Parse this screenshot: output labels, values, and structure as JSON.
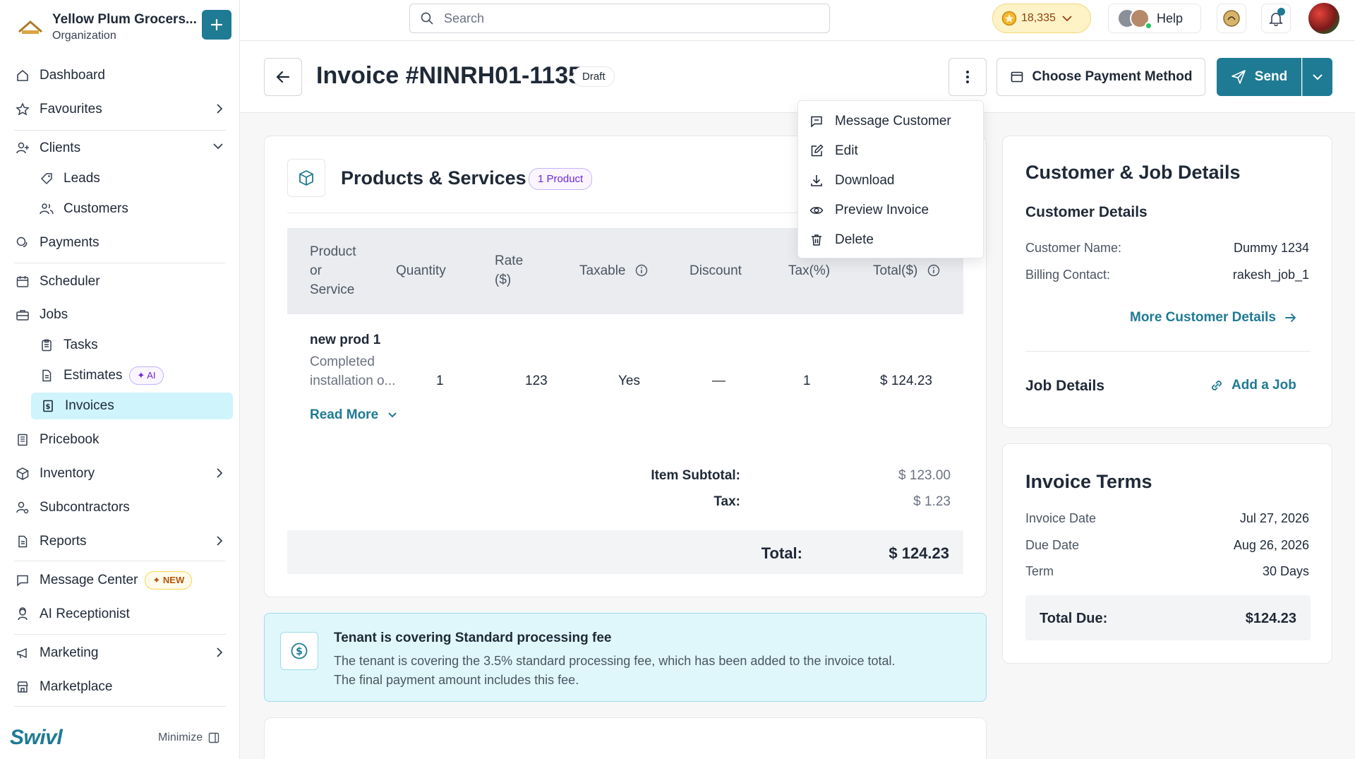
{
  "org": {
    "name": "Yellow Plum Grocers...",
    "type": "Organization"
  },
  "nav": {
    "dashboard": "Dashboard",
    "favourites": "Favourites",
    "clients": "Clients",
    "leads": "Leads",
    "customers": "Customers",
    "payments": "Payments",
    "scheduler": "Scheduler",
    "jobs": "Jobs",
    "tasks": "Tasks",
    "estimates": "Estimates",
    "estimates_badge": "AI",
    "invoices": "Invoices",
    "pricebook": "Pricebook",
    "inventory": "Inventory",
    "subcontractors": "Subcontractors",
    "reports": "Reports",
    "message_center": "Message Center",
    "message_center_badge": "NEW",
    "ai_receptionist": "AI Receptionist",
    "marketing": "Marketing",
    "marketplace": "Marketplace"
  },
  "brand": "Swivl",
  "minimize_label": "Minimize",
  "topbar": {
    "search_placeholder": "Search",
    "coins": "18,335",
    "help": "Help"
  },
  "header": {
    "title": "Invoice #NINRH01-1135",
    "status": "Draft",
    "choose_payment": "Choose Payment Method",
    "send": "Send"
  },
  "menu": {
    "message_customer": "Message Customer",
    "edit": "Edit",
    "download": "Download",
    "preview": "Preview Invoice",
    "delete": "Delete"
  },
  "products": {
    "title": "Products & Services",
    "badge": "1 Product",
    "columns": {
      "product_line1": "Product",
      "product_line2": "or",
      "product_line3": "Service",
      "quantity": "Quantity",
      "rate_line1": "Rate",
      "rate_line2": "($)",
      "taxable": "Taxable",
      "discount": "Discount",
      "tax": "Tax(%)",
      "total": "Total($)"
    },
    "row": {
      "name": "new prod 1",
      "desc_line1": "Completed",
      "desc_line2": "installation o...",
      "quantity": "1",
      "rate": "123",
      "taxable": "Yes",
      "discount": "—",
      "tax": "1",
      "total": "$ 124.23"
    },
    "read_more": "Read More",
    "subtotal_label": "Item Subtotal:",
    "subtotal_value": "$ 123.00",
    "tax_label": "Tax:",
    "tax_value": "$ 1.23",
    "total_label": "Total:",
    "total_value": "$ 124.23"
  },
  "fee": {
    "title": "Tenant is covering Standard processing fee",
    "line1": "The tenant is covering the 3.5% standard processing fee, which has been added to the invoice total.",
    "line2": "The final payment amount includes this fee."
  },
  "customer_card": {
    "title": "Customer & Job Details",
    "customer_details": "Customer Details",
    "name_label": "Customer Name:",
    "name_value": "Dummy 1234",
    "billing_label": "Billing Contact:",
    "billing_value": "rakesh_job_1",
    "more_link": "More Customer Details",
    "job_details": "Job Details",
    "add_job": "Add a Job"
  },
  "terms_card": {
    "title": "Invoice Terms",
    "invoice_date_label": "Invoice Date",
    "invoice_date_value": "Jul 27, 2026",
    "due_date_label": "Due Date",
    "due_date_value": "Aug 26, 2026",
    "term_label": "Term",
    "term_value": "30 Days",
    "total_due_label": "Total Due:",
    "total_due_value": "$124.23"
  }
}
